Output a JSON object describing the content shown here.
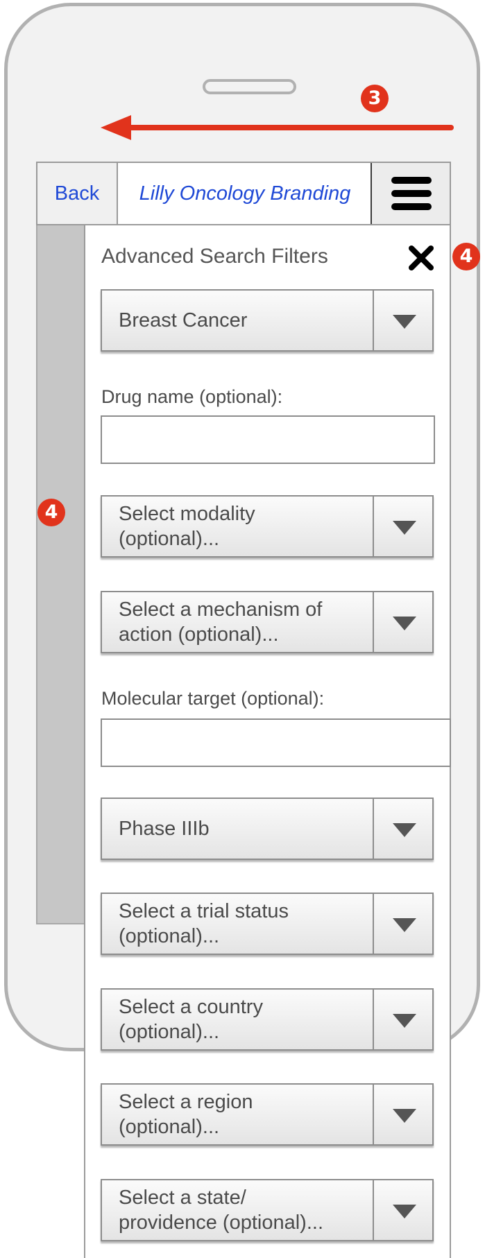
{
  "annotations": {
    "swipe_marker": "3",
    "close_marker": "4",
    "side_marker": "4"
  },
  "appbar": {
    "back_label": "Back",
    "brand_label": "Lilly Oncology Branding"
  },
  "panel": {
    "title": "Advanced Search Filters",
    "cancer_type": "Breast Cancer",
    "drug_label": "Drug name (optional):",
    "drug_value": "",
    "modality": "Select modality (optional)...",
    "mechanism": "Select a mechanism of action (optional)...",
    "target_label": "Molecular target (optional):",
    "target_value": "",
    "phase": "Phase IIIb",
    "trial_status": "Select a trial status (optional)...",
    "country": "Select a country (optional)...",
    "region": "Select a region (optional)...",
    "state": "Select a state/ providence (optional)..."
  },
  "colors": {
    "accent": "#e1331c",
    "link": "#1f49d6",
    "frame": "#b1b1b1"
  },
  "icons": [
    "swipe-left-arrow-icon",
    "menu-icon",
    "close-icon",
    "chevron-down-icon"
  ]
}
